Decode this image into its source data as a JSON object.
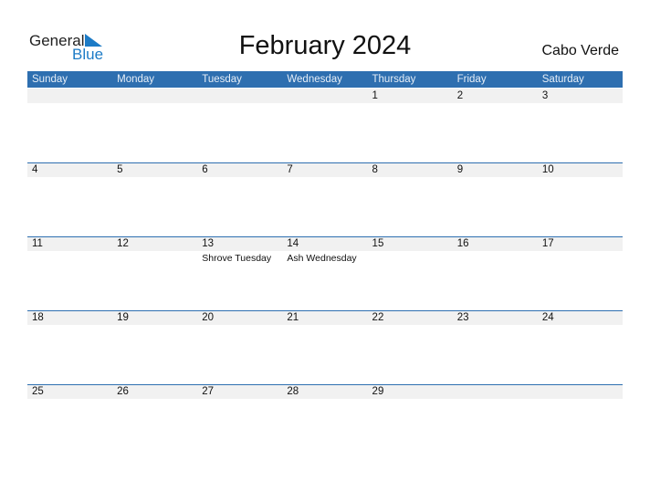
{
  "logo": {
    "general": "General",
    "blue": "Blue"
  },
  "title": "February 2024",
  "country": "Cabo Verde",
  "days": [
    "Sunday",
    "Monday",
    "Tuesday",
    "Wednesday",
    "Thursday",
    "Friday",
    "Saturday"
  ],
  "weeks": [
    [
      {
        "d": ""
      },
      {
        "d": ""
      },
      {
        "d": ""
      },
      {
        "d": ""
      },
      {
        "d": "1"
      },
      {
        "d": "2"
      },
      {
        "d": "3"
      }
    ],
    [
      {
        "d": "4"
      },
      {
        "d": "5"
      },
      {
        "d": "6"
      },
      {
        "d": "7"
      },
      {
        "d": "8"
      },
      {
        "d": "9"
      },
      {
        "d": "10"
      }
    ],
    [
      {
        "d": "11"
      },
      {
        "d": "12"
      },
      {
        "d": "13",
        "e": "Shrove Tuesday"
      },
      {
        "d": "14",
        "e": "Ash Wednesday"
      },
      {
        "d": "15"
      },
      {
        "d": "16"
      },
      {
        "d": "17"
      }
    ],
    [
      {
        "d": "18"
      },
      {
        "d": "19"
      },
      {
        "d": "20"
      },
      {
        "d": "21"
      },
      {
        "d": "22"
      },
      {
        "d": "23"
      },
      {
        "d": "24"
      }
    ],
    [
      {
        "d": "25"
      },
      {
        "d": "26"
      },
      {
        "d": "27"
      },
      {
        "d": "28"
      },
      {
        "d": "29"
      },
      {
        "d": ""
      },
      {
        "d": ""
      }
    ]
  ]
}
